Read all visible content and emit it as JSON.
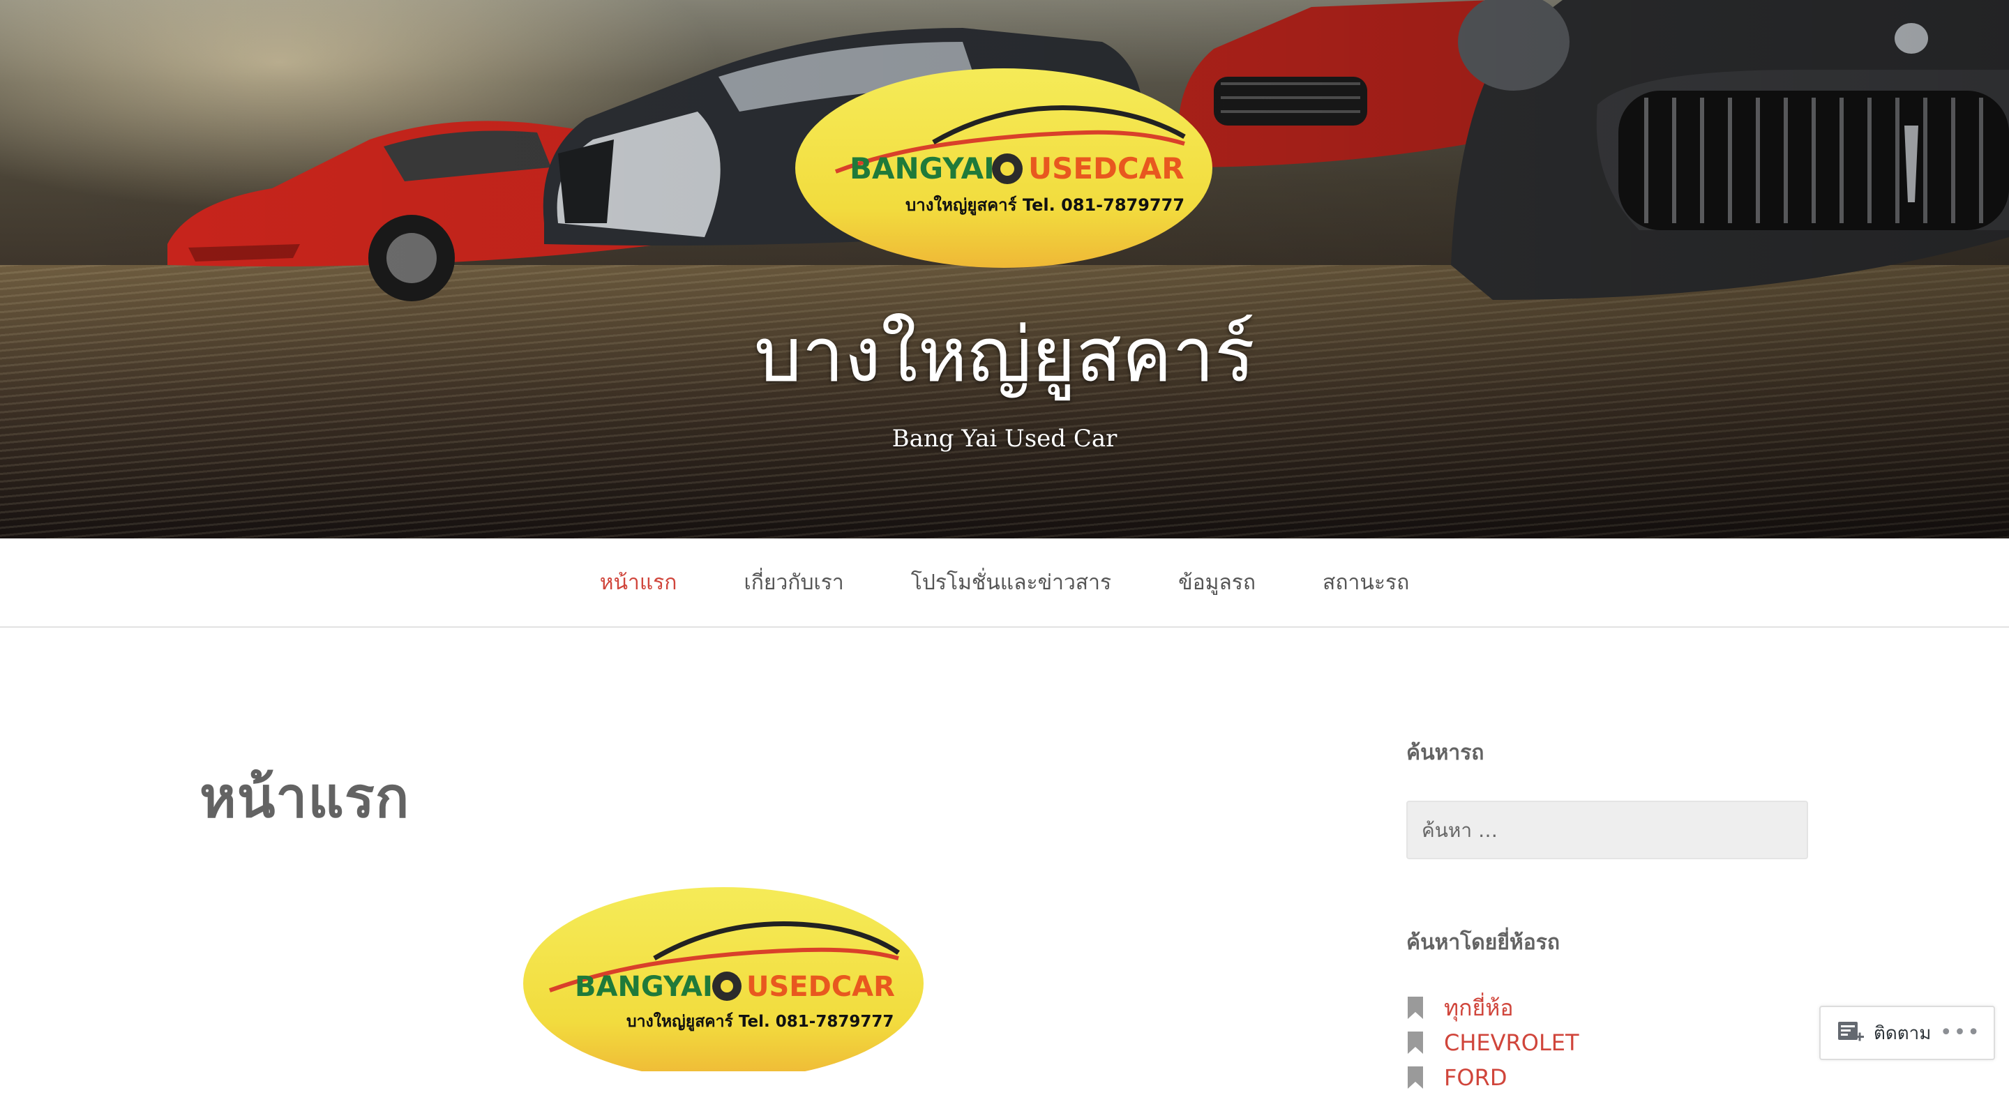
{
  "header": {
    "site_title": "บางใหญ่ยูสคาร์",
    "site_description": "Bang Yai Used Car"
  },
  "logo": {
    "brand_left": "BANGYAI",
    "brand_right": "USEDCAR",
    "tagline": "บางใหญ่ยูสคาร์ Tel. 081-7879777",
    "colors": {
      "background": "#f4e34a",
      "green": "#1f7a3a",
      "orange": "#e8581f"
    }
  },
  "nav": {
    "items": [
      {
        "label": "หน้าแรก",
        "current": true
      },
      {
        "label": "เกี่ยวกับเรา"
      },
      {
        "label": "โปรโมชั่นและข่าวสาร"
      },
      {
        "label": "ข้อมูลรถ"
      },
      {
        "label": "สถานะรถ"
      }
    ]
  },
  "main": {
    "page_title": "หน้าแรก"
  },
  "sidebar": {
    "search_title": "ค้นหารถ",
    "search_placeholder": "ค้นหา …",
    "brand_title": "ค้นหาโดยยี่ห้อรถ",
    "brands": [
      {
        "label": "ทุกยี่ห้อ"
      },
      {
        "label": "CHEVROLET"
      },
      {
        "label": "FORD"
      }
    ]
  },
  "follow": {
    "label": "ติดตาม",
    "more": "•••"
  },
  "theme": {
    "accent": "#d0453b",
    "text": "#636363"
  }
}
